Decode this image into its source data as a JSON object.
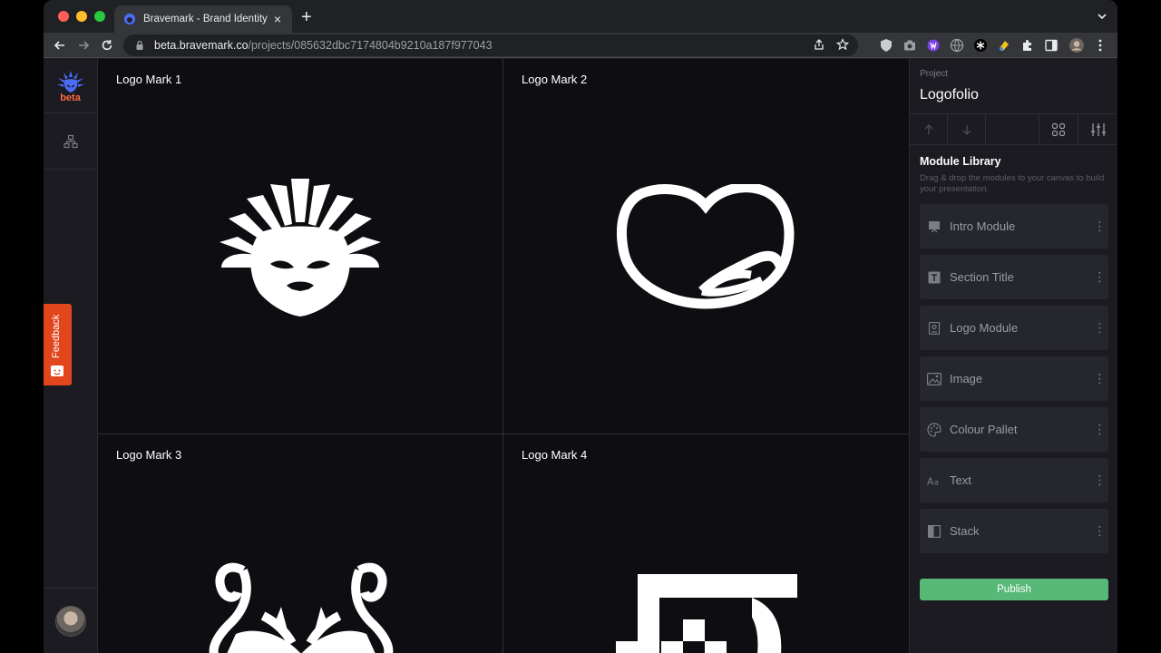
{
  "browser": {
    "tab_title": "Bravemark - Brand Identity De",
    "tab_close": "×",
    "new_tab": "+",
    "url_host": "beta.bravemark.co",
    "url_path": "/projects/085632dbc7174804b9210a187f977043"
  },
  "sidebar": {
    "beta_label": "beta",
    "feedback_label": "Feedback"
  },
  "canvas": {
    "cells": [
      {
        "title": "Logo Mark 1"
      },
      {
        "title": "Logo Mark 2"
      },
      {
        "title": "Logo Mark 3"
      },
      {
        "title": "Logo Mark 4"
      }
    ]
  },
  "panel": {
    "project_label": "Project",
    "project_name": "Logofolio",
    "library_title": "Module Library",
    "library_desc": "Drag & drop the modules to your canvas to build your presentation.",
    "modules": [
      {
        "label": "Intro Module",
        "icon": "presentation-icon"
      },
      {
        "label": "Section Title",
        "icon": "title-icon"
      },
      {
        "label": "Logo Module",
        "icon": "logo-module-icon"
      },
      {
        "label": "Image",
        "icon": "image-icon"
      },
      {
        "label": "Colour Pallet",
        "icon": "palette-icon"
      },
      {
        "label": "Text",
        "icon": "text-icon"
      },
      {
        "label": "Stack",
        "icon": "stack-icon"
      }
    ],
    "more_glyph": "⋮",
    "publish_label": "Publish"
  },
  "colors": {
    "accent_publish": "#57b877",
    "feedback": "#e2461c",
    "brand_blue": "#4a6cf7",
    "beta_orange": "#ff6b3d"
  }
}
